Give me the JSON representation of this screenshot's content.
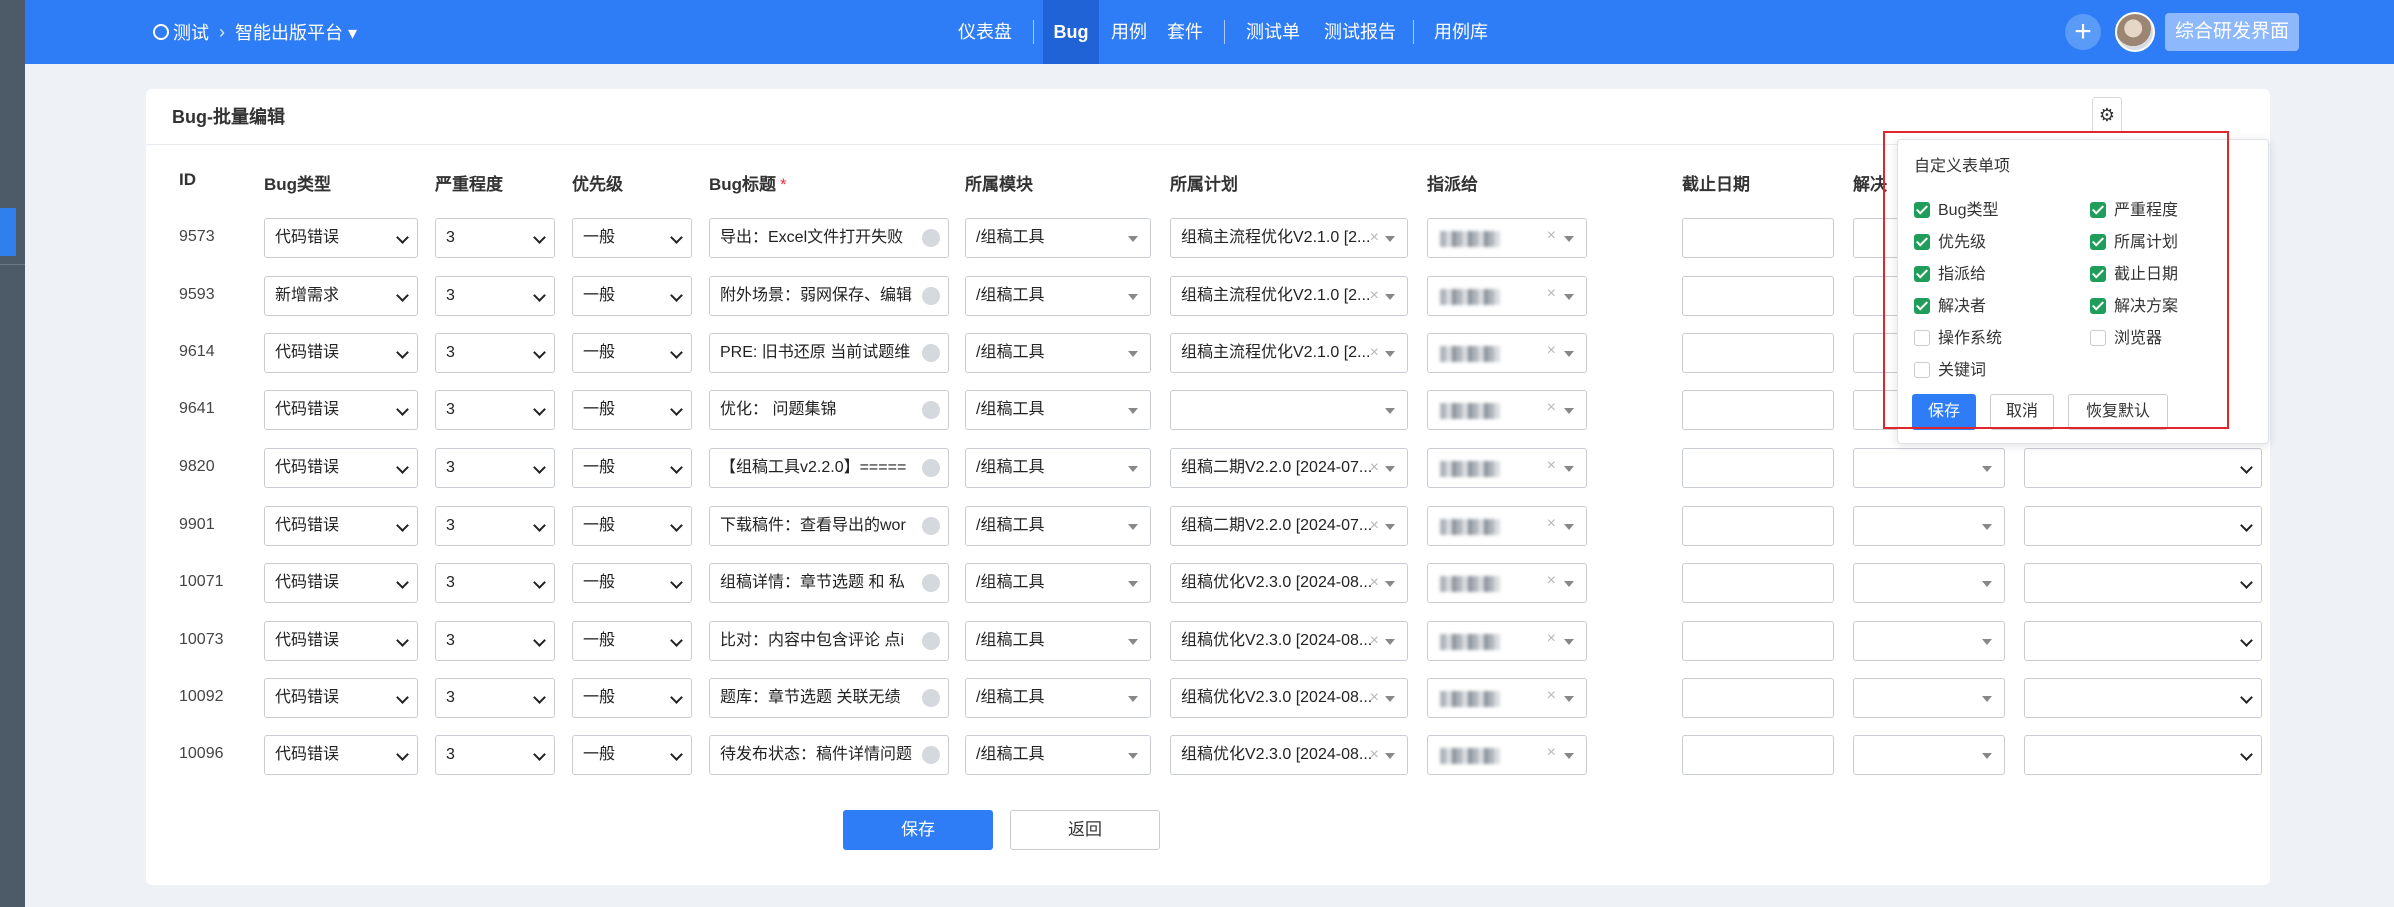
{
  "topbar": {
    "product": "测试",
    "platform": "智能出版平台",
    "nav": [
      {
        "label": "仪表盘"
      },
      {
        "label": "Bug"
      },
      {
        "label": "用例"
      },
      {
        "label": "套件"
      },
      {
        "label": "测试单"
      },
      {
        "label": "测试报告"
      },
      {
        "label": "用例库"
      }
    ],
    "active_nav": "Bug",
    "plus_symbol": "+",
    "user_button": "综合研发界面"
  },
  "page": {
    "title": "Bug-批量编辑",
    "gear_symbol": "⚙"
  },
  "table": {
    "headers": {
      "id": "ID",
      "type": "Bug类型",
      "severity": "严重程度",
      "priority": "优先级",
      "title": "Bug标题",
      "title_required": "*",
      "module": "所属模块",
      "plan": "所属计划",
      "assignee": "指派给",
      "deadline": "截止日期",
      "resolver": "解决"
    },
    "rows": [
      {
        "id": "9573",
        "type": "代码错误",
        "severity": "3",
        "priority": "一般",
        "title": "导出：Excel文件打开失败",
        "module": "/组稿工具",
        "plan": "组稿主流程优化V2.1.0 [2..."
      },
      {
        "id": "9593",
        "type": "新增需求",
        "severity": "3",
        "priority": "一般",
        "title": "附外场景：弱网保存、编辑",
        "module": "/组稿工具",
        "plan": "组稿主流程优化V2.1.0 [2..."
      },
      {
        "id": "9614",
        "type": "代码错误",
        "severity": "3",
        "priority": "一般",
        "title": "PRE: 旧书还原 当前试题维",
        "module": "/组稿工具",
        "plan": "组稿主流程优化V2.1.0 [2..."
      },
      {
        "id": "9641",
        "type": "代码错误",
        "severity": "3",
        "priority": "一般",
        "title": "优化： 问题集锦",
        "module": "/组稿工具",
        "plan": ""
      },
      {
        "id": "9820",
        "type": "代码错误",
        "severity": "3",
        "priority": "一般",
        "title": "【组稿工具v2.2.0】=====",
        "module": "/组稿工具",
        "plan": "组稿二期V2.2.0 [2024-07..."
      },
      {
        "id": "9901",
        "type": "代码错误",
        "severity": "3",
        "priority": "一般",
        "title": "下载稿件：查看导出的wor",
        "module": "/组稿工具",
        "plan": "组稿二期V2.2.0 [2024-07..."
      },
      {
        "id": "10071",
        "type": "代码错误",
        "severity": "3",
        "priority": "一般",
        "title": "组稿详情：章节选题 和 私",
        "module": "/组稿工具",
        "plan": "组稿优化V2.3.0 [2024-08..."
      },
      {
        "id": "10073",
        "type": "代码错误",
        "severity": "3",
        "priority": "一般",
        "title": "比对：内容中包含评论 点i",
        "module": "/组稿工具",
        "plan": "组稿优化V2.3.0 [2024-08..."
      },
      {
        "id": "10092",
        "type": "代码错误",
        "severity": "3",
        "priority": "一般",
        "title": "题库：章节选题 关联无绩",
        "module": "/组稿工具",
        "plan": "组稿优化V2.3.0 [2024-08..."
      },
      {
        "id": "10096",
        "type": "代码错误",
        "severity": "3",
        "priority": "一般",
        "title": "待发布状态：稿件详情问题",
        "module": "/组稿工具",
        "plan": "组稿优化V2.3.0 [2024-08..."
      }
    ],
    "clear_symbol": "×"
  },
  "footer": {
    "save": "保存",
    "back": "返回"
  },
  "popover": {
    "title": "自定义表单项",
    "options": [
      {
        "label": "Bug类型",
        "checked": true
      },
      {
        "label": "严重程度",
        "checked": true
      },
      {
        "label": "优先级",
        "checked": true
      },
      {
        "label": "所属计划",
        "checked": true
      },
      {
        "label": "指派给",
        "checked": true
      },
      {
        "label": "截止日期",
        "checked": true
      },
      {
        "label": "解决者",
        "checked": true
      },
      {
        "label": "解决方案",
        "checked": true
      },
      {
        "label": "操作系统",
        "checked": false
      },
      {
        "label": "浏览器",
        "checked": false
      },
      {
        "label": "关键词",
        "checked": false
      }
    ],
    "save": "保存",
    "cancel": "取消",
    "reset": "恢复默认"
  },
  "colors": {
    "brand": "#2e7cf6",
    "checkbox_checked": "#1e9e5a",
    "highlight_outline": "#e0262c"
  }
}
